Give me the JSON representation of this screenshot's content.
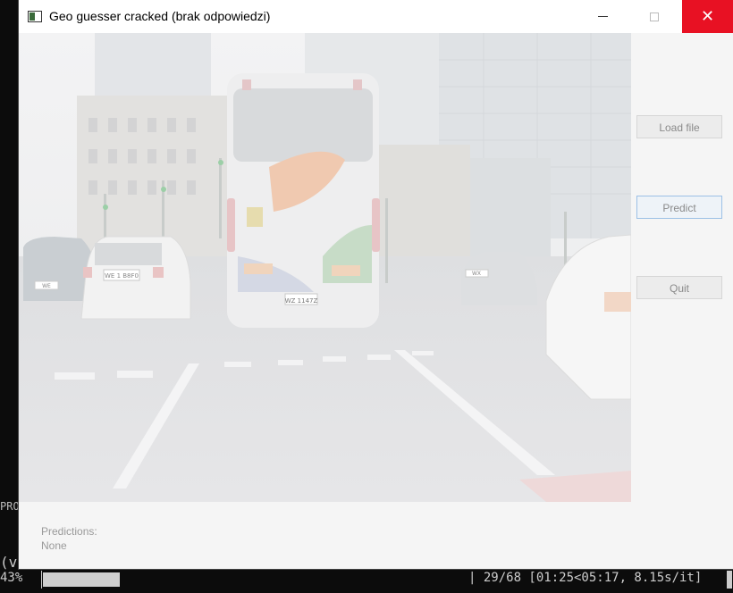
{
  "window": {
    "title": "Geo guesser cracked (brak odpowiedzi)",
    "controls": {
      "minimize": "minimize",
      "maximize": "maximize",
      "close": "✕"
    }
  },
  "buttons": {
    "load_file": "Load file",
    "predict": "Predict",
    "quit": "Quit"
  },
  "predictions": {
    "label": "Predictions:",
    "value": "None"
  },
  "scene": {
    "bus_plate": "WZ 1147Z",
    "car_left_plate": "WE 1 B8F0",
    "car_far_plate": "WE",
    "car_right_plate": "WX"
  },
  "terminal": {
    "fragment_pr": "PRO",
    "fragment_paren": "(v",
    "progress_percent": "43%",
    "progress_fraction": 0.43,
    "progress_rest": "| 29/68 [01:25<05:17,  8.15s/it]"
  }
}
